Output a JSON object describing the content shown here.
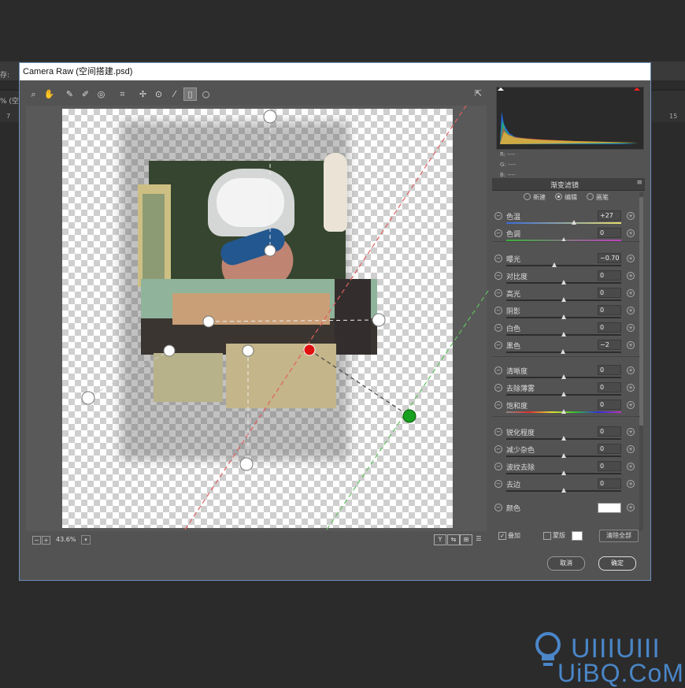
{
  "background": {
    "left_label_1": "存:",
    "left_label_2": "% (空",
    "ruler_left": "7",
    "ruler_right": "15"
  },
  "dialog": {
    "title": "Camera Raw (空间搭建.psd)"
  },
  "toolbar": {
    "tools": [
      "zoom-icon",
      "hand-icon",
      "white-balance-icon",
      "color-sampler-icon",
      "targeted-adjustment-icon",
      "crop-icon",
      "spot-removal-icon",
      "red-eye-icon",
      "adjustment-brush-icon",
      "graduated-filter-icon",
      "radial-filter-icon"
    ],
    "active_tool": "graduated-filter-icon"
  },
  "bottom_bar": {
    "zoom_minus": "−",
    "zoom_plus": "+",
    "zoom_value": "43.6%",
    "view_y": "Y",
    "view_compare": "⇆",
    "view_swap": "⊞"
  },
  "panel": {
    "rgb": {
      "r": "R:  ----",
      "g": "G:  ----",
      "b": "B:  ----"
    },
    "title": "渐变滤镜",
    "menu_icon": "≡",
    "modes": [
      {
        "label": "新建",
        "selected": false
      },
      {
        "label": "编辑",
        "selected": true
      },
      {
        "label": "画笔",
        "selected": false
      }
    ],
    "sliders": [
      {
        "label": "色温",
        "value": "+27",
        "pos": 0.59
      },
      {
        "label": "色调",
        "value": "0",
        "pos": 0.5
      },
      {
        "label": "曝光",
        "value": "−0.70",
        "pos": 0.42
      },
      {
        "label": "对比度",
        "value": "0",
        "pos": 0.5
      },
      {
        "label": "高光",
        "value": "0",
        "pos": 0.5
      },
      {
        "label": "阴影",
        "value": "0",
        "pos": 0.5
      },
      {
        "label": "白色",
        "value": "0",
        "pos": 0.5
      },
      {
        "label": "黑色",
        "value": "−2",
        "pos": 0.49
      },
      {
        "label": "清晰度",
        "value": "0",
        "pos": 0.5
      },
      {
        "label": "去除薄雾",
        "value": "0",
        "pos": 0.5
      },
      {
        "label": "饱和度",
        "value": "0",
        "pos": 0.5
      },
      {
        "label": "锐化程度",
        "value": "0",
        "pos": 0.5
      },
      {
        "label": "减少杂色",
        "value": "0",
        "pos": 0.5
      },
      {
        "label": "波纹去除",
        "value": "0",
        "pos": 0.5
      },
      {
        "label": "去边",
        "value": "0",
        "pos": 0.5
      }
    ],
    "color_label": "颜色",
    "overlay_label": "叠加",
    "overlay_checked": true,
    "mask_label": "蒙版",
    "mask_checked": false,
    "clear_all": "清除全部"
  },
  "buttons": {
    "cancel": "取消",
    "ok": "确定"
  },
  "watermark": {
    "top": "UIIIUIII",
    "bottom": "UiBQ.CoM"
  },
  "colors": {
    "dialog_bg": "#535353",
    "accent_red_pin": "#e01010",
    "accent_green_pin": "#18a020"
  }
}
